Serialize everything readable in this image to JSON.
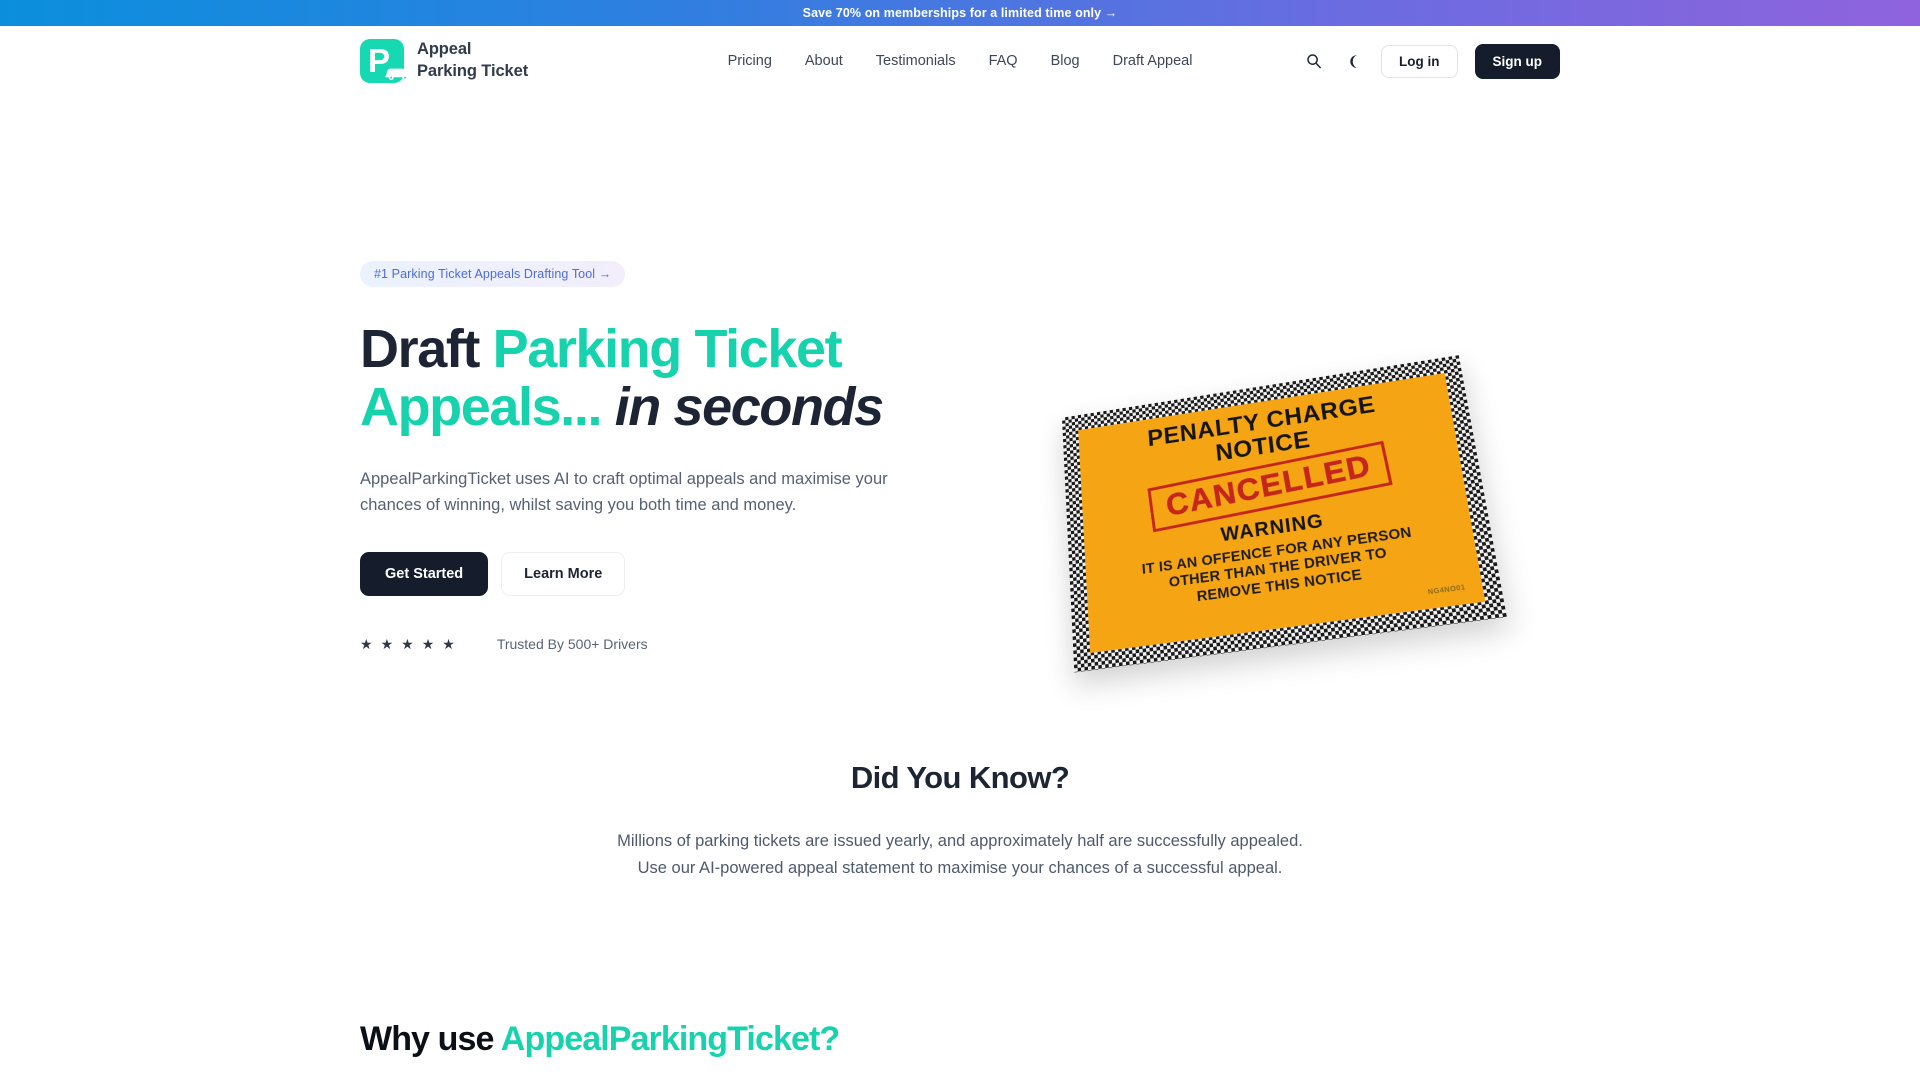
{
  "promo": {
    "text": "Save 70% on memberships for a limited time only →"
  },
  "colors": {
    "accent_teal": "#16d3ad",
    "dark": "#151c2b",
    "badge_text": "#4e6ae0",
    "banner_from": "#0b8fdd",
    "banner_to": "#8f63dd",
    "ticket_orange": "#f5a513",
    "stamp_red": "#c4261b"
  },
  "header": {
    "brand": {
      "logo_icon": "parking-p-car-icon",
      "line1": "Appeal",
      "line2": "Parking Ticket",
      "letter": "P"
    },
    "nav": [
      {
        "label": "Pricing"
      },
      {
        "label": "About"
      },
      {
        "label": "Testimonials"
      },
      {
        "label": "FAQ"
      },
      {
        "label": "Blog"
      },
      {
        "label": "Draft Appeal"
      }
    ],
    "actions": {
      "search_icon": "search-icon",
      "theme_icon": "moon-icon",
      "login_label": "Log in",
      "signup_label": "Sign up"
    }
  },
  "hero": {
    "badge": "#1 Parking Ticket Appeals Drafting Tool →",
    "title": {
      "part1": "Draft ",
      "part2": "Parking Ticket Appeals",
      "part3": "...",
      "part4": " in seconds"
    },
    "subtitle": "AppealParkingTicket uses AI to craft optimal appeals and maximise your chances of winning, whilst saving you both time and money.",
    "cta_primary": "Get Started",
    "cta_secondary": "Learn More",
    "rating_stars": 5,
    "star_glyph": "★",
    "trust_text": "Trusted By 500+ Drivers",
    "image": {
      "alt_name": "penalty-charge-notice-cancelled",
      "line1": "PENALTY CHARGE",
      "line2": "NOTICE",
      "stamp": "CANCELLED",
      "warning": "WARNING",
      "body_line1": "IT IS AN OFFENCE FOR ANY PERSON",
      "body_line2": "OTHER THAN THE DRIVER TO",
      "body_line3": "REMOVE THIS NOTICE",
      "code": "NG4NO01"
    }
  },
  "did_you_know": {
    "title": "Did You Know?",
    "body": "Millions of parking tickets are issued yearly, and approximately half are successfully appealed. Use our AI-powered appeal statement to maximise your chances of a successful appeal."
  },
  "why_use": {
    "title_part1": "Why use ",
    "title_part2": "AppealParkingTicket?"
  }
}
